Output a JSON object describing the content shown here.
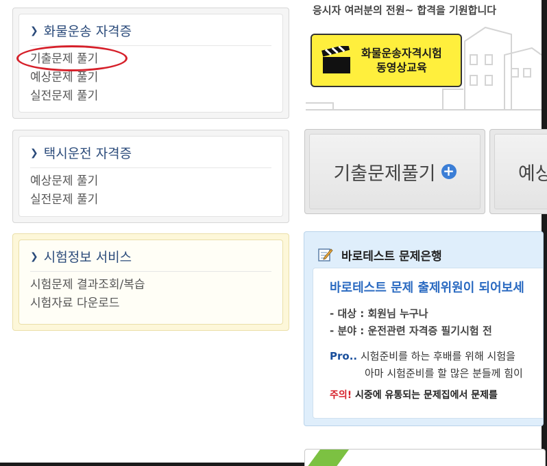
{
  "sidebar": {
    "cargo": {
      "title": "화물운송 자격증",
      "links": [
        "기출문제 풀기",
        "예상문제 풀기",
        "실전문제 풀기"
      ]
    },
    "taxi": {
      "title": "택시운전 자격증",
      "links": [
        "예상문제 풀기",
        "실전문제 풀기"
      ]
    },
    "exam_info": {
      "title": "시험정보 서비스",
      "links": [
        "시험문제 결과조회/복습",
        "시험자료 다운로드"
      ]
    }
  },
  "banner": {
    "slogan": "응시자 여러분의 전원~ 합격을 기원합니다",
    "video_line1": "화물운송자격시험",
    "video_line2": "동영상교육"
  },
  "tiles": {
    "past_exam": "기출문제풀기",
    "expected_partial": "예상"
  },
  "question_bank": {
    "title": "바로테스트 문제은행",
    "headline": "바로테스트 문제 출제위원이 되어보세",
    "target": "- 대상 : 회원님 누구나",
    "field": "- 분야 : 운전관련 자격증 필기시험 전",
    "pro_label": "Pro..",
    "pro_line1": "시험준비를 하는 후배를 위해 시험을",
    "pro_line2": "아마 시험준비를 할 많은 분들께 힘이",
    "warn_label": "주의!",
    "warn_text": "시중에 유통되는 문제집에서 문제를"
  },
  "colors": {
    "accent_blue": "#2a6ac1",
    "highlight_red": "#d6202a",
    "video_yellow": "#ffef3d"
  }
}
